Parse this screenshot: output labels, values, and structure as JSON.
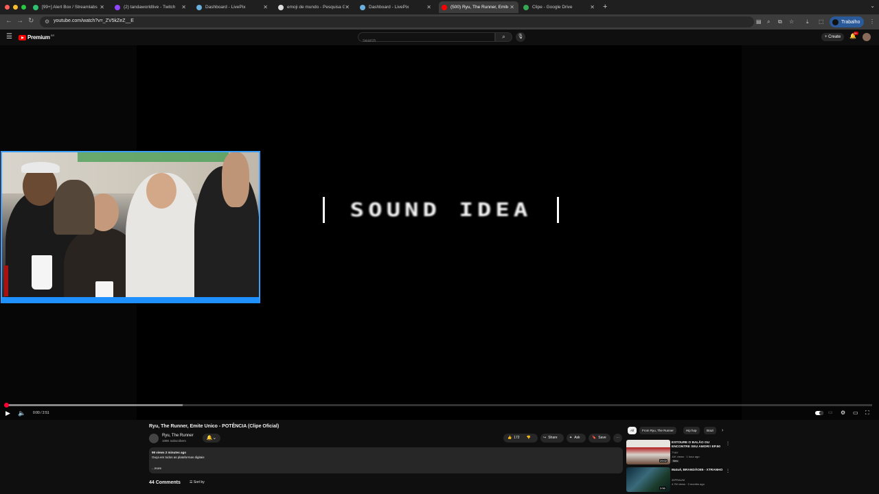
{
  "browser": {
    "tabs": [
      {
        "title": "[99+] Alert Box / Streamlabs",
        "fav": "#2fbf71"
      },
      {
        "title": "(2) tandaworldlive - Twitch",
        "fav": "#9146ff"
      },
      {
        "title": "Dashboard - LivePix",
        "fav": "#6ab0de"
      },
      {
        "title": "emoji de mundo - Pesquisa G",
        "fav": "#dddddd"
      },
      {
        "title": "Dashboard - LivePix",
        "fav": "#6ab0de"
      },
      {
        "title": "(500) Ryu, The Runner, Emite",
        "fav": "#ff0000"
      },
      {
        "title": "Clipe - Google Drive",
        "fav": "#34a853"
      }
    ],
    "url": "youtube.com/watch?v=_ZV5kZeZ__E",
    "profile_label": "Trabalho"
  },
  "youtube": {
    "logo_text": "Premium",
    "logo_region": "BR",
    "search_placeholder": "Search",
    "create_label": "+ Create",
    "notif_count": "9+"
  },
  "player": {
    "overlay_text": "SOUND IDEA",
    "time": "0:00 / 2:51",
    "progress_fraction": 0.0
  },
  "video": {
    "title": "Ryu, The Runner, Emite Unico - POTÊNCIA (Clipe Oficial)",
    "channel": "Ryu, The Runner",
    "subscribers": "108K subscribers",
    "likes": "172",
    "share_label": "Share",
    "ask_label": "Ask",
    "save_label": "Save",
    "views_meta": "98 views  2 minutes ago",
    "desc_line": "Ouça em todos as plataformas digitais",
    "more_label": "...more",
    "comments_count": "44 Comments",
    "sort_label": "Sort by"
  },
  "sidebar": {
    "chips": [
      "All",
      "From Ryu, The Runner",
      "Hip hop",
      "Brazi"
    ],
    "recs": [
      {
        "title": "ESTOURE O BALÃO OU ENCONTRE SEU AMOR!! EP.50",
        "channel": "7YAY",
        "meta": "11K views · 1 hour ago",
        "badge": "New",
        "duration": "29:02"
      },
      {
        "title": "Matuê, BRANDÃO85 - XTRANHO",
        "channel": "30PRAUM",
        "meta": "4.7M views · 3 months ago",
        "badge": "",
        "duration": "3:56"
      }
    ]
  }
}
